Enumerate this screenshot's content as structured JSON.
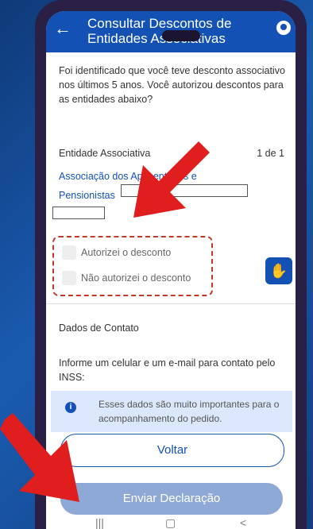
{
  "header": {
    "title": "Consultar Descontos de Entidades Associativas",
    "back_icon": "arrow-left-icon",
    "user_icon": "user-icon"
  },
  "intro_text": "Foi identificado que você teve desconto associativo nos últimos 5 anos. Você autorizou descontos para as entidades abaixo?",
  "entity_section": {
    "label": "Entidade Associativa",
    "pagination": "1 de 1",
    "entity_name": "Associação dos Aposentados e Pensionistas"
  },
  "options": [
    {
      "label": "Autorizei o desconto",
      "checked": false
    },
    {
      "label": "Não autorizei o desconto",
      "checked": false
    }
  ],
  "contact": {
    "title": "Dados de Contato",
    "prompt": "Informe um celular e um e-mail para contato pelo INSS:"
  },
  "info_box": {
    "text": "Esses dados são muito importantes para o acompanhamento do pedido."
  },
  "buttons": {
    "back_label": "Voltar",
    "submit_label": "Enviar Declaração"
  },
  "colors": {
    "primary": "#1351b4",
    "annotation_red": "#e01e1e",
    "dashed_border": "#c0392b",
    "info_bg": "#dbe8fb"
  }
}
